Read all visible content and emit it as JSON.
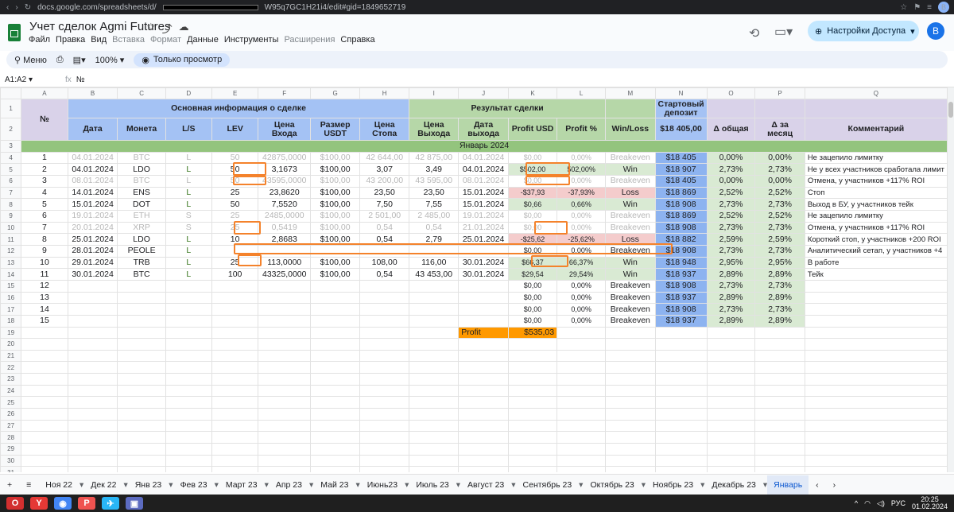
{
  "browser": {
    "url_start": "docs.google.com/spreadsheets/d/",
    "url_end": "W95q7GC1H21i4/edit#gid=1849652719",
    "profile": "B"
  },
  "doc": {
    "title": "Учет сделок Agmi Futures"
  },
  "menu": [
    "Файл",
    "Правка",
    "Вид",
    "Вставка",
    "Формат",
    "Данные",
    "Инструменты",
    "Расширения",
    "Справка"
  ],
  "menu_disabled": [
    "Вставка",
    "Формат",
    "Расширения"
  ],
  "share_label": "Настройки Доступа",
  "avatar": "B",
  "toolbar": {
    "menu_label": "Меню",
    "zoom": "100%",
    "view_only": "Только просмотр"
  },
  "formula": {
    "namebox": "A1:A2",
    "value": "№"
  },
  "columns": [
    "A",
    "B",
    "C",
    "D",
    "E",
    "F",
    "G",
    "H",
    "I",
    "J",
    "K",
    "L",
    "M",
    "N",
    "O",
    "P",
    "Q"
  ],
  "headers": {
    "group_main": "Основная информация о сделке",
    "group_result": "Результат сделки",
    "start_deposit": "Стартовый депозит",
    "deposit_value": "$18 405,00",
    "col_no": "№",
    "date": "Дата",
    "coin": "Монета",
    "ls": "L/S",
    "lev": "LEV",
    "entry": "Цена Входа",
    "size": "Размер USDT",
    "stop": "Цена Стопа",
    "exit": "Цена Выхода",
    "exit_date": "Дата выхода",
    "profit_usd": "Profit USD",
    "profit_pct": "Profit %",
    "winloss": "Win/Loss",
    "total": "Δ общая",
    "month": "Δ за месяц",
    "comment": "Комментарий"
  },
  "month_label": "Январь 2024",
  "trades": [
    {
      "n": "1",
      "date": "04.01.2024",
      "coin": "BTC",
      "ls": "L",
      "lev": "50",
      "entry": "42875,0000",
      "size": "$100,00",
      "stop": "42 644,00",
      "exit": "42 875,00",
      "edate": "04.01.2024",
      "pusd": "$0,00",
      "ppct": "0,00%",
      "wl": "Breakeven",
      "dep": "$18 405",
      "tot": "0,00%",
      "mon": "0,00%",
      "com": "Не зацепило лимитку",
      "dim": true
    },
    {
      "n": "2",
      "date": "04.01.2024",
      "coin": "LDO",
      "ls": "L",
      "lev": "50",
      "entry": "3,1673",
      "size": "$100,00",
      "stop": "3,07",
      "exit": "3,49",
      "edate": "04.01.2024",
      "pusd": "$502,00",
      "ppct": "502,00%",
      "wl": "Win",
      "dep": "$18 907",
      "tot": "2,73%",
      "mon": "2,73%",
      "com": "Не у всех участников сработала лимит",
      "dim": false
    },
    {
      "n": "3",
      "date": "08.01.2024",
      "coin": "BTC",
      "ls": "L",
      "lev": "50",
      "entry": "43595,0000",
      "size": "$100,00",
      "stop": "43 200,00",
      "exit": "43 595,00",
      "edate": "08.01.2024",
      "pusd": "$0,00",
      "ppct": "0,00%",
      "wl": "Breakeven",
      "dep": "$18 405",
      "tot": "0,00%",
      "mon": "0,00%",
      "com": "Отмена, у участников +117% ROI",
      "dim": true
    },
    {
      "n": "4",
      "date": "14.01.2024",
      "coin": "ENS",
      "ls": "L",
      "lev": "25",
      "entry": "23,8620",
      "size": "$100,00",
      "stop": "23,50",
      "exit": "23,50",
      "edate": "15.01.2024",
      "pusd": "-$37,93",
      "ppct": "-37,93%",
      "wl": "Loss",
      "dep": "$18 869",
      "tot": "2,52%",
      "mon": "2,52%",
      "com": "Стоп",
      "dim": false
    },
    {
      "n": "5",
      "date": "15.01.2024",
      "coin": "DOT",
      "ls": "L",
      "lev": "50",
      "entry": "7,5520",
      "size": "$100,00",
      "stop": "7,50",
      "exit": "7,55",
      "edate": "15.01.2024",
      "pusd": "$0,66",
      "ppct": "0,66%",
      "wl": "Win",
      "dep": "$18 908",
      "tot": "2,73%",
      "mon": "2,73%",
      "com": "Выход в БУ, у участников тейк",
      "dim": false
    },
    {
      "n": "6",
      "date": "19.01.2024",
      "coin": "ETH",
      "ls": "S",
      "lev": "25",
      "entry": "2485,0000",
      "size": "$100,00",
      "stop": "2 501,00",
      "exit": "2 485,00",
      "edate": "19.01.2024",
      "pusd": "$0,00",
      "ppct": "0,00%",
      "wl": "Breakeven",
      "dep": "$18 869",
      "tot": "2,52%",
      "mon": "2,52%",
      "com": "Не зацепило лимитку",
      "dim": true
    },
    {
      "n": "7",
      "date": "20.01.2024",
      "coin": "XRP",
      "ls": "S",
      "lev": "25",
      "entry": "0,5419",
      "size": "$100,00",
      "stop": "0,54",
      "exit": "0,54",
      "edate": "21.01.2024",
      "pusd": "$0,00",
      "ppct": "0,00%",
      "wl": "Breakeven",
      "dep": "$18 908",
      "tot": "2,73%",
      "mon": "2,73%",
      "com": "Отмена, у участников +117% ROI",
      "dim": true
    },
    {
      "n": "8",
      "date": "25.01.2024",
      "coin": "LDO",
      "ls": "L",
      "lev": "10",
      "entry": "2,8683",
      "size": "$100,00",
      "stop": "0,54",
      "exit": "2,79",
      "edate": "25.01.2024",
      "pusd": "-$25,62",
      "ppct": "-25,62%",
      "wl": "Loss",
      "dep": "$18 882",
      "tot": "2,59%",
      "mon": "2,59%",
      "com": "Короткий стоп, у участников +200 ROI",
      "dim": false
    },
    {
      "n": "9",
      "date": "28.01.2024",
      "coin": "PEOLE",
      "ls": "L",
      "lev": "",
      "entry": "",
      "size": "",
      "stop": "",
      "exit": "",
      "edate": "",
      "pusd": "$0,00",
      "ppct": "0,00%",
      "wl": "Breakeven",
      "dep": "$18 908",
      "tot": "2,73%",
      "mon": "2,73%",
      "com": "Аналитический сетап, у участников +4",
      "dim": false
    },
    {
      "n": "10",
      "date": "29.01.2024",
      "coin": "TRB",
      "ls": "L",
      "lev": "25",
      "entry": "113,0000",
      "size": "$100,00",
      "stop": "108,00",
      "exit": "116,00",
      "edate": "30.01.2024",
      "pusd": "$66,37",
      "ppct": "66,37%",
      "wl": "Win",
      "dep": "$18 948",
      "tot": "2,95%",
      "mon": "2,95%",
      "com": "В работе",
      "dim": false
    },
    {
      "n": "11",
      "date": "30.01.2024",
      "coin": "BTC",
      "ls": "L",
      "lev": "100",
      "entry": "43325,0000",
      "size": "$100,00",
      "stop": "0,54",
      "exit": "43 453,00",
      "edate": "30.01.2024",
      "pusd": "$29,54",
      "ppct": "29,54%",
      "wl": "Win",
      "dep": "$18 937",
      "tot": "2,89%",
      "mon": "2,89%",
      "com": "Тейк",
      "dim": false
    },
    {
      "n": "12",
      "date": "",
      "coin": "",
      "ls": "",
      "lev": "",
      "entry": "",
      "size": "",
      "stop": "",
      "exit": "",
      "edate": "",
      "pusd": "$0,00",
      "ppct": "0,00%",
      "wl": "Breakeven",
      "dep": "$18 908",
      "tot": "2,73%",
      "mon": "2,73%",
      "com": "",
      "dim": false
    },
    {
      "n": "13",
      "date": "",
      "coin": "",
      "ls": "",
      "lev": "",
      "entry": "",
      "size": "",
      "stop": "",
      "exit": "",
      "edate": "",
      "pusd": "$0,00",
      "ppct": "0,00%",
      "wl": "Breakeven",
      "dep": "$18 937",
      "tot": "2,89%",
      "mon": "2,89%",
      "com": "",
      "dim": false
    },
    {
      "n": "14",
      "date": "",
      "coin": "",
      "ls": "",
      "lev": "",
      "entry": "",
      "size": "",
      "stop": "",
      "exit": "",
      "edate": "",
      "pusd": "$0,00",
      "ppct": "0,00%",
      "wl": "Breakeven",
      "dep": "$18 908",
      "tot": "2,73%",
      "mon": "2,73%",
      "com": "",
      "dim": false
    },
    {
      "n": "15",
      "date": "",
      "coin": "",
      "ls": "",
      "lev": "",
      "entry": "",
      "size": "",
      "stop": "",
      "exit": "",
      "edate": "",
      "pusd": "$0,00",
      "ppct": "0,00%",
      "wl": "Breakeven",
      "dep": "$18 937",
      "tot": "2,89%",
      "mon": "2,89%",
      "com": "",
      "dim": false
    }
  ],
  "profit_row": {
    "label": "Profit",
    "value": "$535,03"
  },
  "tabs": [
    "Ноя 22",
    "Дек 22",
    "Янв 23",
    "Фев 23",
    "Март 23",
    "Апр 23",
    "Май 23",
    "Июнь23",
    "Июль 23",
    "Август 23",
    "Сентябрь 23",
    "Октябрь 23",
    "Ноябрь 23",
    "Декабрь 23",
    "Январь"
  ],
  "taskbar": {
    "lang": "РУС",
    "time": "20:25",
    "date": "01.02.2024"
  },
  "colors": {
    "header_blue": "#a4c2f4",
    "result_green": "#b6d7a8",
    "deposit_purple": "#d9d2e9",
    "win_green": "#d9ead3",
    "loss_red": "#f4cccc",
    "deposit_blue": "#8db3f0",
    "month_bar": "#93c47d",
    "profit_orange": "#ff9900",
    "highlight_box": "#f4822b"
  }
}
